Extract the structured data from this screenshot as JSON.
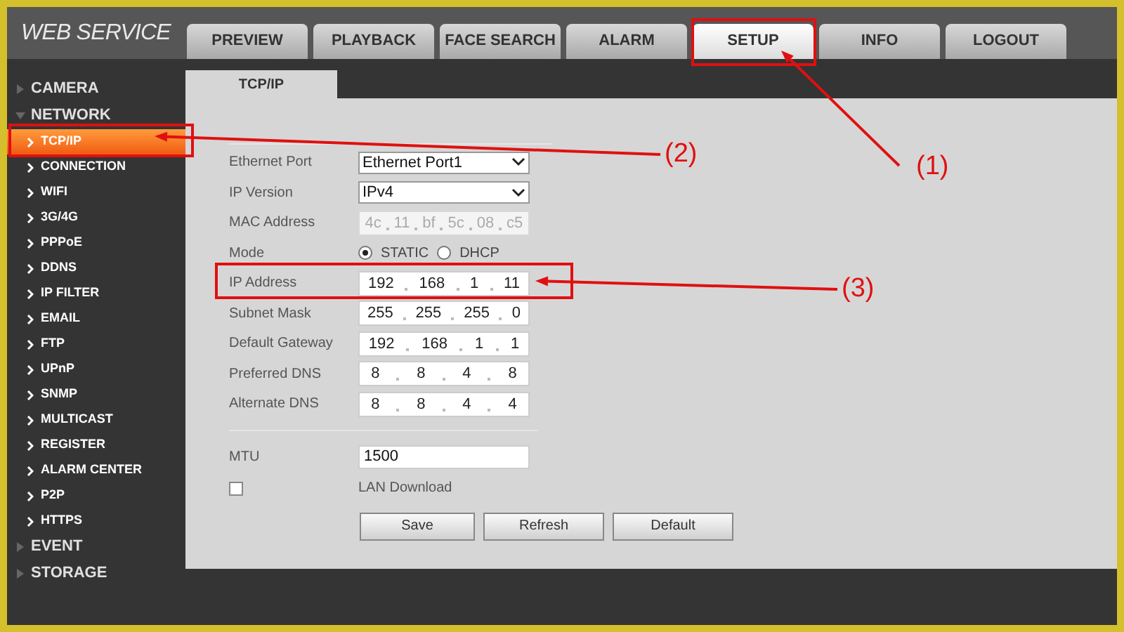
{
  "header": {
    "logo": "WEB SERVICE"
  },
  "tabs": [
    {
      "label": "PREVIEW",
      "selected": false
    },
    {
      "label": "PLAYBACK",
      "selected": false
    },
    {
      "label": "FACE SEARCH",
      "selected": false
    },
    {
      "label": "ALARM",
      "selected": false
    },
    {
      "label": "SETUP",
      "selected": true
    },
    {
      "label": "INFO",
      "selected": false
    },
    {
      "label": "LOGOUT",
      "selected": false
    }
  ],
  "sidebar": {
    "items": [
      {
        "label": "CAMERA",
        "expanded": false
      },
      {
        "label": "NETWORK",
        "expanded": true,
        "children": [
          {
            "label": "TCP/IP",
            "selected": true
          },
          {
            "label": "CONNECTION",
            "selected": false
          },
          {
            "label": "WIFI",
            "selected": false
          },
          {
            "label": "3G/4G",
            "selected": false
          },
          {
            "label": "PPPoE",
            "selected": false
          },
          {
            "label": "DDNS",
            "selected": false
          },
          {
            "label": "IP FILTER",
            "selected": false
          },
          {
            "label": "EMAIL",
            "selected": false
          },
          {
            "label": "FTP",
            "selected": false
          },
          {
            "label": "UPnP",
            "selected": false
          },
          {
            "label": "SNMP",
            "selected": false
          },
          {
            "label": "MULTICAST",
            "selected": false
          },
          {
            "label": "REGISTER",
            "selected": false
          },
          {
            "label": "ALARM CENTER",
            "selected": false
          },
          {
            "label": "P2P",
            "selected": false
          },
          {
            "label": "HTTPS",
            "selected": false
          }
        ]
      },
      {
        "label": "EVENT",
        "expanded": false
      },
      {
        "label": "STORAGE",
        "expanded": false
      }
    ]
  },
  "page_tab": {
    "label": "TCP/IP"
  },
  "form": {
    "fields": [
      {
        "kind": "select",
        "label": "Ethernet Port",
        "value": "Ethernet Port1"
      },
      {
        "kind": "select",
        "label": "IP Version",
        "value": "IPv4"
      },
      {
        "kind": "address",
        "label": "MAC Address",
        "disabled": true,
        "parts": [
          "4c",
          "11",
          "bf",
          "5c",
          "08",
          "c5"
        ]
      },
      {
        "kind": "radio",
        "label": "Mode",
        "options": [
          {
            "label": "STATIC",
            "selected": true
          },
          {
            "label": "DHCP",
            "selected": false
          }
        ]
      },
      {
        "kind": "address",
        "label": "IP Address",
        "disabled": false,
        "parts": [
          "192",
          "168",
          "1",
          "11"
        ]
      },
      {
        "kind": "address",
        "label": "Subnet Mask",
        "disabled": false,
        "parts": [
          "255",
          "255",
          "255",
          "0"
        ]
      },
      {
        "kind": "address",
        "label": "Default Gateway",
        "disabled": false,
        "parts": [
          "192",
          "168",
          "1",
          "1"
        ]
      },
      {
        "kind": "address",
        "label": "Preferred DNS",
        "disabled": false,
        "parts": [
          "8",
          "8",
          "4",
          "8"
        ]
      },
      {
        "kind": "address",
        "label": "Alternate DNS",
        "disabled": false,
        "parts": [
          "8",
          "8",
          "4",
          "4"
        ]
      },
      {
        "kind": "divider"
      },
      {
        "kind": "text",
        "label": "MTU",
        "value": "1500"
      },
      {
        "kind": "checkbox",
        "label": "LAN Download",
        "checked": false
      }
    ],
    "buttons": [
      "Save",
      "Refresh",
      "Default"
    ]
  },
  "annotations": [
    {
      "label": "(1)"
    },
    {
      "label": "(2)"
    },
    {
      "label": "(3)"
    }
  ]
}
